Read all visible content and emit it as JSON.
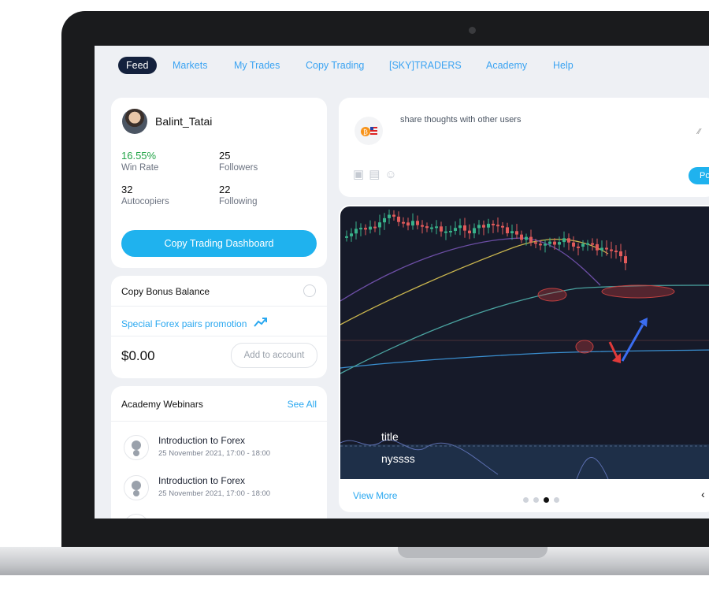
{
  "nav": {
    "items": [
      "Feed",
      "Markets",
      "My Trades",
      "Copy Trading",
      "[SKY]TRADERS",
      "Academy",
      "Help"
    ],
    "active": "Feed"
  },
  "profile": {
    "username": "Balint_Tatai",
    "win_rate_value": "16.55%",
    "win_rate_label": "Win Rate",
    "followers_value": "25",
    "followers_label": "Followers",
    "autocopiers_value": "32",
    "autocopiers_label": "Autocopiers",
    "following_value": "22",
    "following_label": "Following",
    "dashboard_button": "Copy Trading Dashboard"
  },
  "bonus": {
    "title": "Copy Bonus Balance",
    "promo": "Special Forex pairs promotion",
    "balance": "$0.00",
    "add_button": "Add to account"
  },
  "webinars": {
    "title": "Academy Webinars",
    "see_all": "See All",
    "items": [
      {
        "name": "Introduction to Forex",
        "date": "25 November 2021, 17:00 - 18:00"
      },
      {
        "name": "Introduction to Forex",
        "date": "25 November 2021, 17:00 - 18:00"
      }
    ]
  },
  "post": {
    "placeholder": "share thoughts with other users",
    "button": "Po"
  },
  "chart": {
    "label_1": "title",
    "label_2": "nyssss",
    "view_more": "View More",
    "prev": "‹"
  },
  "colors": {
    "accent": "#1fb2ee",
    "nav_active_bg": "#14213d",
    "positive": "#22a447",
    "chart_bg": "#161a29"
  }
}
